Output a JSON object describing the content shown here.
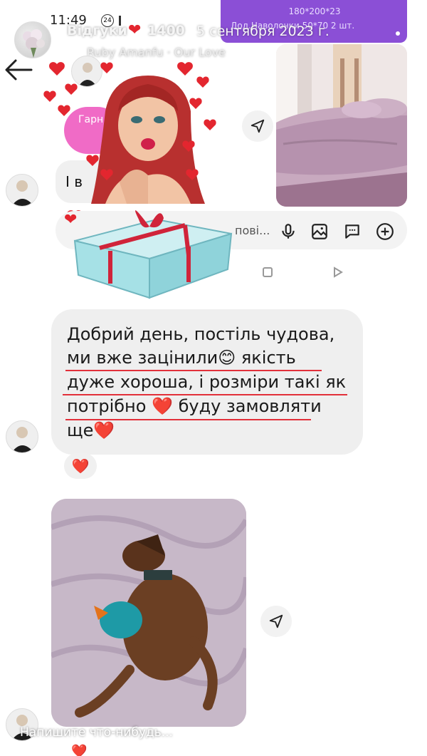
{
  "status": {
    "time": "11:49",
    "badge": "24"
  },
  "story": {
    "title": "Відгуки",
    "count": "1400",
    "date": "5 сентября 2023 г.",
    "music": "Ruby Amanfu · Our Love"
  },
  "order_card": {
    "line1": "180*200*23",
    "line2": "Дод.Наволочки 50*70 2 шт."
  },
  "chat_partial": {
    "text": "І в"
  },
  "pink_bubble": {
    "text": "Гарн"
  },
  "composer": {
    "placeholder": "пові..."
  },
  "review": {
    "lines": [
      "Добрий день, постіль чудова,",
      "ми вже зацінили😊 якість",
      "дуже хороша, і розміри такі як",
      "потрібно ❤️ буду замовляти",
      "ще❤️"
    ],
    "reaction": "❤️"
  },
  "bottom": {
    "prompt": "Напишите что-нибудь...",
    "reaction": "❤️"
  },
  "colors": {
    "accent_purple": "#8b4fd6",
    "heart_red": "#e3262f",
    "bubble_gray": "#efefef"
  },
  "icons": [
    "back-arrow-icon",
    "send-icon",
    "microphone-icon",
    "gallery-icon",
    "chat-icon",
    "plus-icon",
    "gift-box-sticker",
    "girl-kiss-sticker"
  ]
}
